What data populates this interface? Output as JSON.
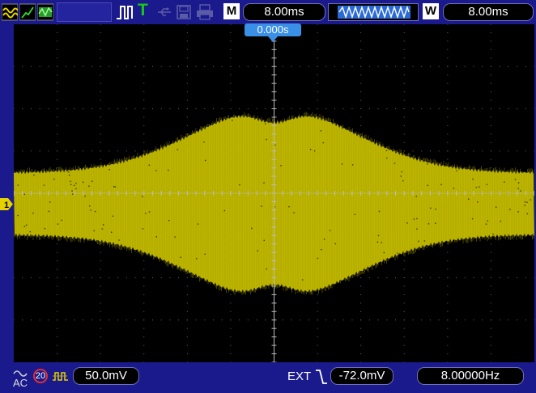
{
  "top": {
    "timebase_badge": "M",
    "timebase": "8.00ms",
    "window_badge": "W",
    "window_timebase": "8.00ms"
  },
  "trigger": {
    "time_offset": "0.000s",
    "channel_marker": "1"
  },
  "bottom": {
    "coupling": "AC",
    "bw_limit": "20",
    "volts_div": "50.0mV",
    "trigger_source": "EXT",
    "trigger_level": "-72.0mV",
    "frequency": "8.00000Hz"
  },
  "colors": {
    "trace": "#c8c000",
    "frame": "#1a1a8c",
    "grid": "#6a6a6a",
    "accent": "#3a8fe6"
  }
}
